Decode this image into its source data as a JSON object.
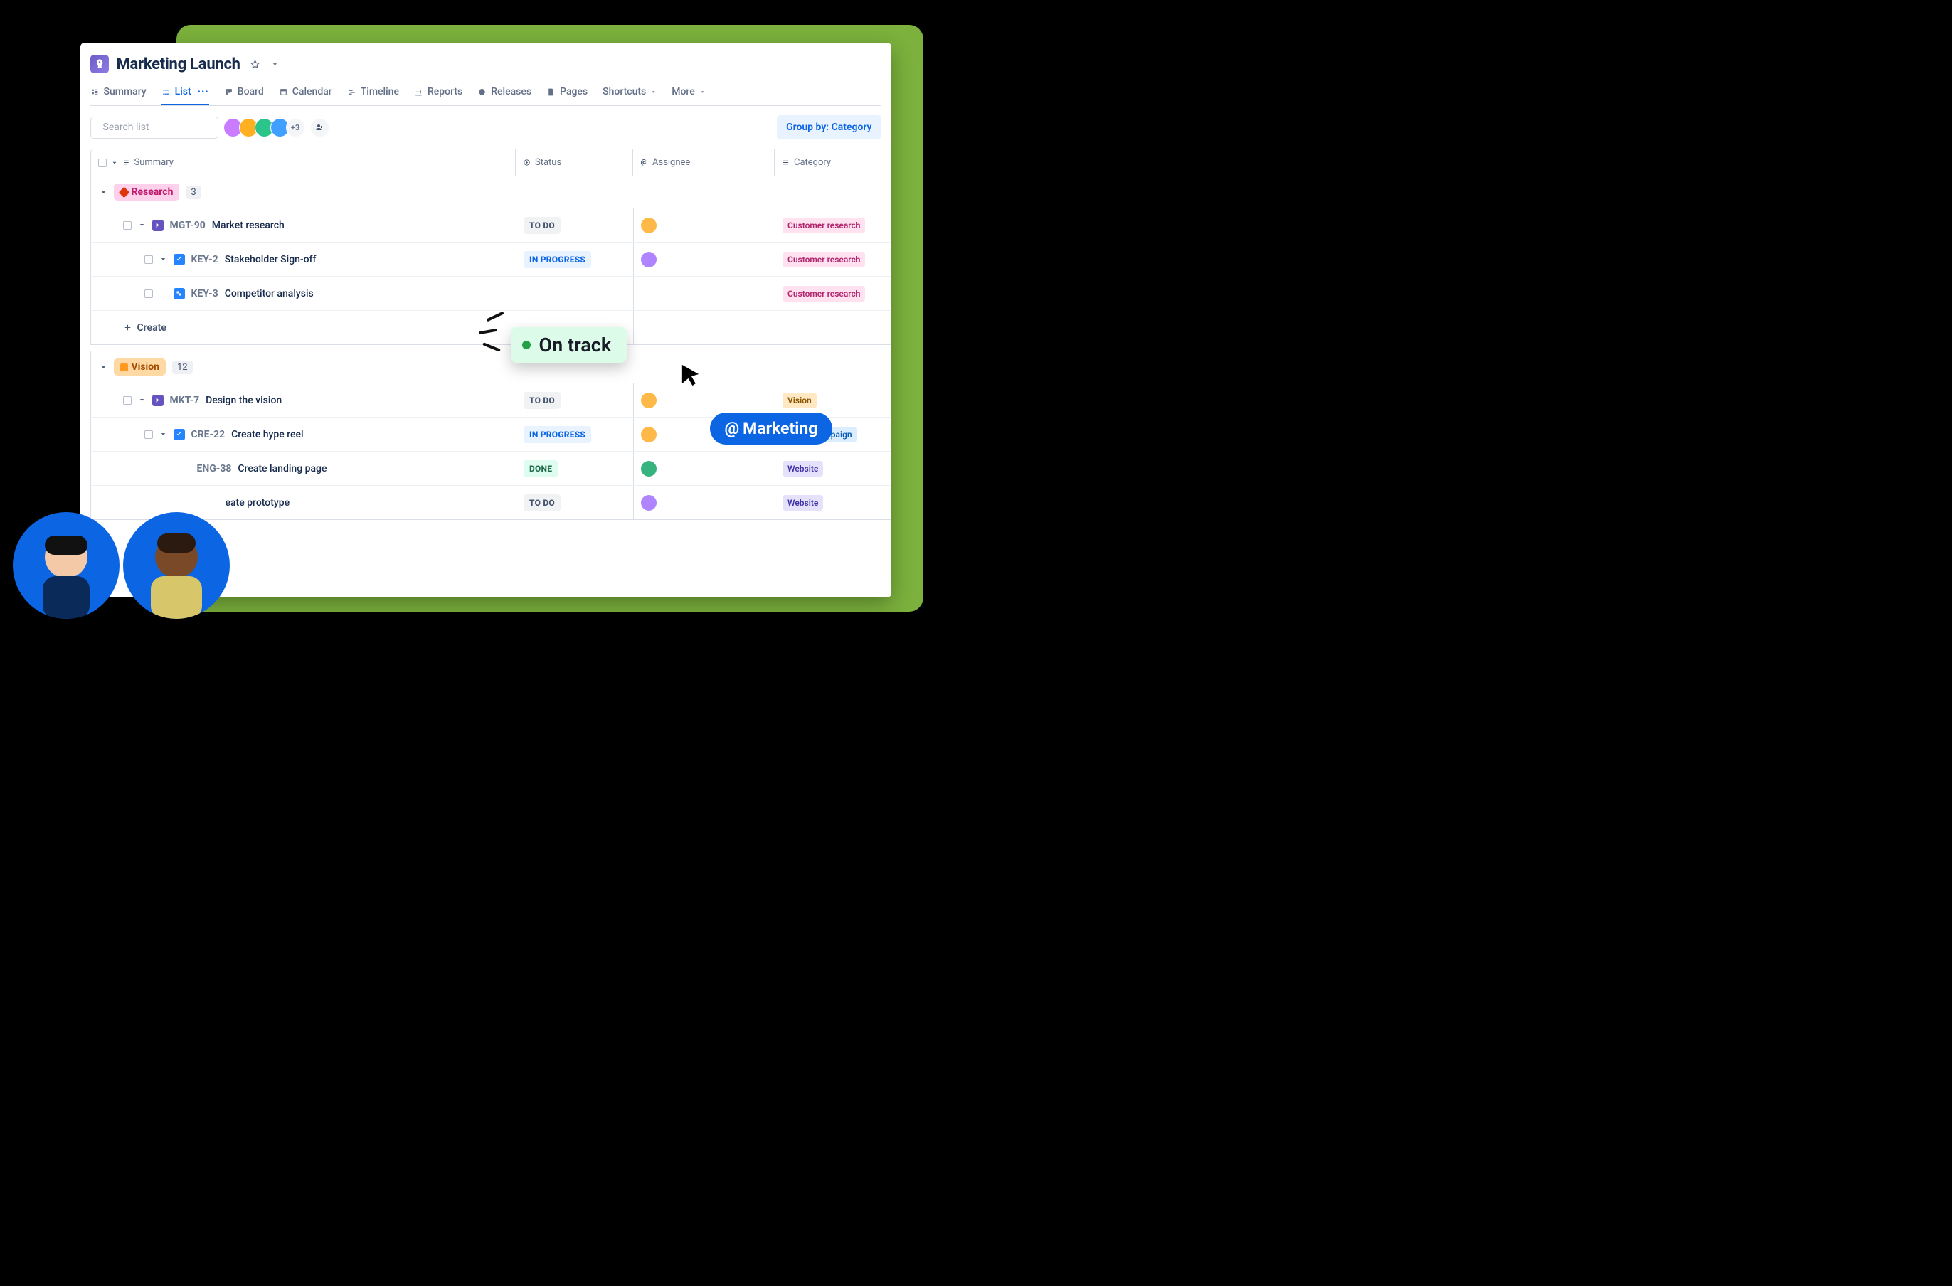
{
  "project": {
    "title": "Marketing Launch"
  },
  "tabs": {
    "summary": "Summary",
    "list": "List",
    "board": "Board",
    "calendar": "Calendar",
    "timeline": "Timeline",
    "reports": "Reports",
    "releases": "Releases",
    "pages": "Pages",
    "shortcuts": "Shortcuts",
    "more": "More"
  },
  "toolbar": {
    "search_placeholder": "Search list",
    "avatar_more": "+3",
    "group_by": "Group by: Category"
  },
  "columns": {
    "summary": "Summary",
    "status": "Status",
    "assignee": "Assignee",
    "category": "Category"
  },
  "groups": [
    {
      "id": "research",
      "label": "Research",
      "count": "3",
      "rows": [
        {
          "indent": 1,
          "icon": "story",
          "key": "MGT-90",
          "title": "Market research",
          "status": "TO DO",
          "status_kind": "todo",
          "category": "Customer research",
          "category_kind": "customer",
          "assignee_color": "p1"
        },
        {
          "indent": 2,
          "icon": "task",
          "key": "KEY-2",
          "title": "Stakeholder Sign-off",
          "status": "IN PROGRESS",
          "status_kind": "inprog",
          "category": "Customer research",
          "category_kind": "customer",
          "assignee_color": "p2"
        },
        {
          "indent": 2,
          "icon": "sub",
          "key": "KEY-3",
          "title": "Competitor analysis",
          "status": "",
          "status_kind": "",
          "category": "Customer research",
          "category_kind": "customer",
          "assignee_color": ""
        }
      ],
      "create_label": "Create"
    },
    {
      "id": "vision",
      "label": "Vision",
      "count": "12",
      "rows": [
        {
          "indent": 1,
          "icon": "story",
          "key": "MKT-7",
          "title": "Design the vision",
          "status": "TO DO",
          "status_kind": "todo",
          "category": "Vision",
          "category_kind": "vision",
          "assignee_color": "p1"
        },
        {
          "indent": 2,
          "icon": "task",
          "key": "CRE-22",
          "title": "Create hype reel",
          "status": "IN PROGRESS",
          "status_kind": "inprog",
          "category": "Social Campaign",
          "category_kind": "social",
          "assignee_color": "p1"
        },
        {
          "indent": 2,
          "icon": "",
          "key": "ENG-38",
          "title": "Create landing page",
          "status": "DONE",
          "status_kind": "done",
          "category": "Website",
          "category_kind": "website",
          "assignee_color": "p3"
        },
        {
          "indent": 2,
          "icon": "",
          "key": "",
          "title": "eate prototype",
          "status": "TO DO",
          "status_kind": "todo",
          "category": "Website",
          "category_kind": "website",
          "assignee_color": "p4"
        }
      ]
    }
  ],
  "overlay": {
    "ontrack": "On track",
    "mention": "Marketing"
  }
}
